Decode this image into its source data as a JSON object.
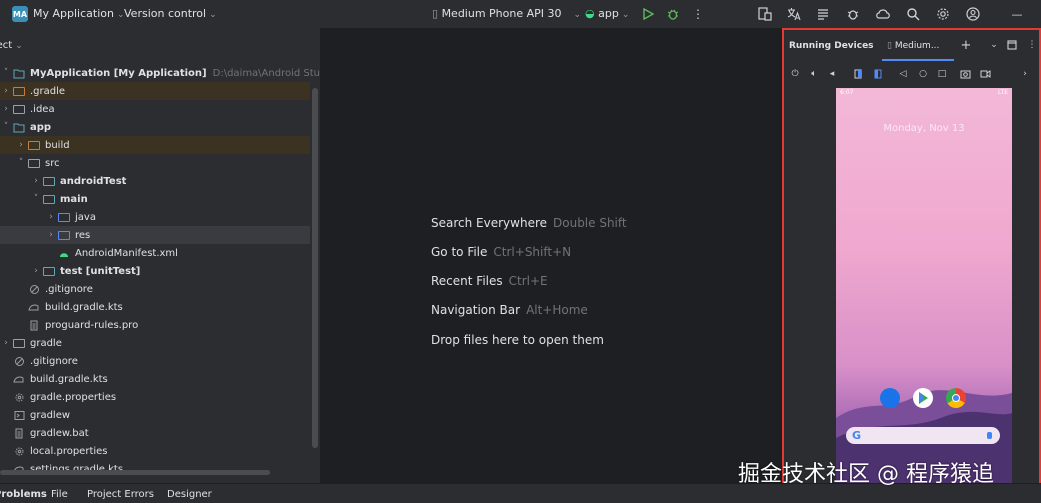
{
  "topbar": {
    "app_badge": "MA",
    "project_name": "My Application",
    "vcs": "Version control",
    "device": "Medium Phone API 30",
    "run_config": "app"
  },
  "project": {
    "title": "Project",
    "tree": [
      {
        "indent": 0,
        "arrow": "˅",
        "icon": "module",
        "label": "MyApplication [My Application]",
        "bold": true,
        "extra": "D:\\daima\\Android Studio\\MyApplic",
        "hl": ""
      },
      {
        "indent": 0,
        "arrow": "›",
        "icon": "folder-orange",
        "label": ".gradle",
        "bold": false,
        "extra": "",
        "hl": "orange"
      },
      {
        "indent": 0,
        "arrow": "›",
        "icon": "folder",
        "label": ".idea",
        "bold": false,
        "extra": "",
        "hl": ""
      },
      {
        "indent": 0,
        "arrow": "˅",
        "icon": "module",
        "label": "app",
        "bold": true,
        "extra": "",
        "hl": ""
      },
      {
        "indent": 1,
        "arrow": "›",
        "icon": "folder-orange",
        "label": "build",
        "bold": false,
        "extra": "",
        "hl": "orange"
      },
      {
        "indent": 1,
        "arrow": "˅",
        "icon": "folder",
        "label": "src",
        "bold": false,
        "extra": "",
        "hl": ""
      },
      {
        "indent": 2,
        "arrow": "›",
        "icon": "folder-teal",
        "label": "androidTest",
        "bold": true,
        "extra": "",
        "hl": ""
      },
      {
        "indent": 2,
        "arrow": "˅",
        "icon": "folder-teal",
        "label": "main",
        "bold": true,
        "extra": "",
        "hl": ""
      },
      {
        "indent": 3,
        "arrow": "›",
        "icon": "folder-blue",
        "label": "java",
        "bold": false,
        "extra": "",
        "hl": ""
      },
      {
        "indent": 3,
        "arrow": "›",
        "icon": "folder-blue",
        "label": "res",
        "bold": false,
        "extra": "",
        "hl": "sel"
      },
      {
        "indent": 3,
        "arrow": "",
        "icon": "android",
        "label": "AndroidManifest.xml",
        "bold": false,
        "extra": "",
        "hl": ""
      },
      {
        "indent": 2,
        "arrow": "›",
        "icon": "folder-teal",
        "label": "test [unitTest]",
        "bold": true,
        "extra": "",
        "hl": ""
      },
      {
        "indent": 1,
        "arrow": "",
        "icon": "ignore",
        "label": ".gitignore",
        "bold": false,
        "extra": "",
        "hl": ""
      },
      {
        "indent": 1,
        "arrow": "",
        "icon": "gradle",
        "label": "build.gradle.kts",
        "bold": false,
        "extra": "",
        "hl": ""
      },
      {
        "indent": 1,
        "arrow": "",
        "icon": "text",
        "label": "proguard-rules.pro",
        "bold": false,
        "extra": "",
        "hl": ""
      },
      {
        "indent": 0,
        "arrow": "›",
        "icon": "folder",
        "label": "gradle",
        "bold": false,
        "extra": "",
        "hl": ""
      },
      {
        "indent": 0,
        "arrow": "",
        "icon": "ignore",
        "label": ".gitignore",
        "bold": false,
        "extra": "",
        "hl": ""
      },
      {
        "indent": 0,
        "arrow": "",
        "icon": "gradle",
        "label": "build.gradle.kts",
        "bold": false,
        "extra": "",
        "hl": ""
      },
      {
        "indent": 0,
        "arrow": "",
        "icon": "settings",
        "label": "gradle.properties",
        "bold": false,
        "extra": "",
        "hl": ""
      },
      {
        "indent": 0,
        "arrow": "",
        "icon": "terminal",
        "label": "gradlew",
        "bold": false,
        "extra": "",
        "hl": ""
      },
      {
        "indent": 0,
        "arrow": "",
        "icon": "text",
        "label": "gradlew.bat",
        "bold": false,
        "extra": "",
        "hl": ""
      },
      {
        "indent": 0,
        "arrow": "",
        "icon": "settings",
        "label": "local.properties",
        "bold": false,
        "extra": "",
        "hl": ""
      },
      {
        "indent": 0,
        "arrow": "",
        "icon": "gradle",
        "label": "settings.gradle.kts",
        "bold": false,
        "extra": "",
        "hl": ""
      }
    ]
  },
  "editor": {
    "hints": [
      {
        "label": "Search Everywhere",
        "key": "Double Shift"
      },
      {
        "label": "Go to File",
        "key": "Ctrl+Shift+N"
      },
      {
        "label": "Recent Files",
        "key": "Ctrl+E"
      },
      {
        "label": "Navigation Bar",
        "key": "Alt+Home"
      },
      {
        "label": "Drop files here to open them",
        "key": ""
      }
    ]
  },
  "devices": {
    "title": "Running Devices",
    "tab": "Medium...",
    "phone": {
      "time": "6:07",
      "signal": "LTE",
      "date": "Monday, Nov 13"
    }
  },
  "bottom": {
    "tabs": [
      "Problems",
      "File",
      "Project Errors",
      "Designer"
    ]
  },
  "watermark": "掘金技术社区 @ 程序猿追",
  "colors": {
    "accent": "#548af7",
    "highlight_border": "#e53935",
    "panel_bg": "#2b2d30",
    "editor_bg": "#1e1f22"
  }
}
